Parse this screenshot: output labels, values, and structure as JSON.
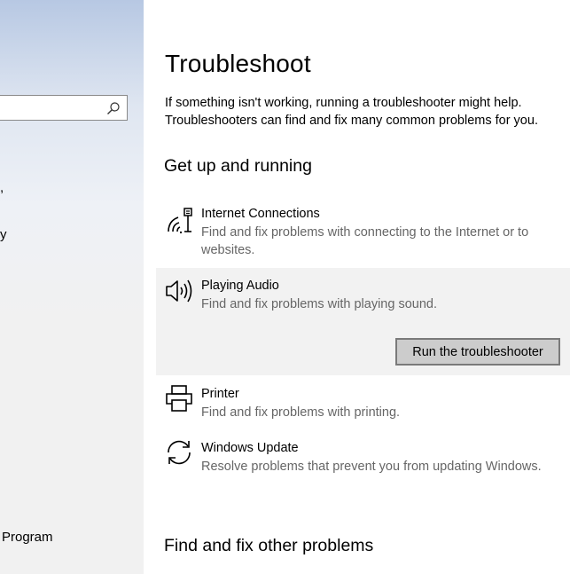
{
  "sidebar": {
    "search": {
      "value": "",
      "placeholder": ""
    },
    "fragments": [
      ",",
      "y"
    ],
    "bottom_item": "Program"
  },
  "main": {
    "title": "Troubleshoot",
    "intro": "If something isn't working, running a troubleshooter might help. Troubleshooters can find and fix many common problems for you.",
    "section1": {
      "heading": "Get up and running",
      "items": [
        {
          "name": "Internet Connections",
          "description": "Find and fix problems with connecting to the Internet or to websites.",
          "icon": "wifi-router-icon"
        },
        {
          "name": "Playing Audio",
          "description": "Find and fix problems with playing sound.",
          "icon": "speaker-icon",
          "selected": true,
          "button": "Run the troubleshooter"
        },
        {
          "name": "Printer",
          "description": "Find and fix problems with printing.",
          "icon": "printer-icon"
        },
        {
          "name": "Windows Update",
          "description": "Resolve problems that prevent you from updating Windows.",
          "icon": "sync-icon"
        }
      ]
    },
    "section2": {
      "heading": "Find and fix other problems"
    }
  },
  "colors": {
    "selected_background": "#f2f2f2",
    "description_text": "#666666",
    "button_background": "#cccccc",
    "button_border": "#7a7a7a",
    "sidebar_background": "#f1f1f1"
  }
}
